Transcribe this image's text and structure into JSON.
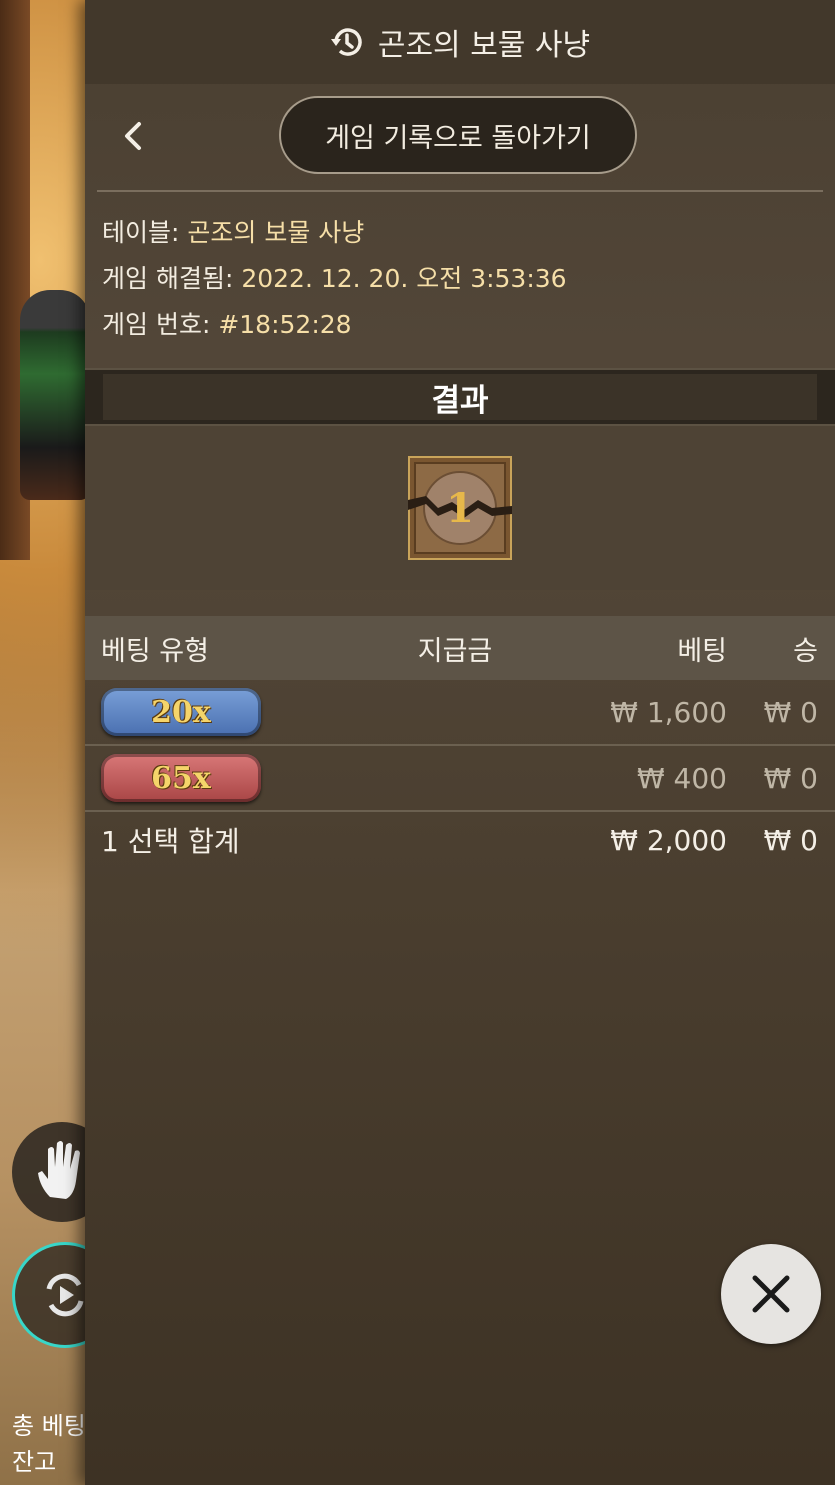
{
  "header": {
    "title": "곤조의 보물 사냥"
  },
  "nav": {
    "back_to_history": "게임 기록으로 돌아가기"
  },
  "info": {
    "table_label": "테이블:",
    "table_value": "곤조의 보물 사냥",
    "resolved_label": "게임 해결됨:",
    "resolved_value": "2022. 12. 20. 오전 3:53:36",
    "number_label": "게임 번호:",
    "number_value": "#18:52:28"
  },
  "result": {
    "heading": "결과",
    "value": "1"
  },
  "table": {
    "headers": {
      "type": "베팅 유형",
      "payout": "지급금",
      "bet": "베팅",
      "win": "승"
    },
    "rows": [
      {
        "badge": "20x",
        "badge_color": "#4a6fb0",
        "payout": "",
        "bet": "₩ 1,600",
        "win": "₩ 0"
      },
      {
        "badge": "65x",
        "badge_color": "#a84545",
        "payout": "",
        "bet": "₩ 400",
        "win": "₩ 0"
      }
    ],
    "total": {
      "label": "1 선택 합계",
      "bet": "₩ 2,000",
      "win": "₩ 0"
    }
  },
  "background": {
    "total_bet_label": "총 베팅금",
    "balance_label": "잔고"
  },
  "icons": {
    "header": "history-icon",
    "back": "chevron-left-icon",
    "close": "close-icon",
    "hand": "hand-icon",
    "replay": "replay-icon"
  }
}
